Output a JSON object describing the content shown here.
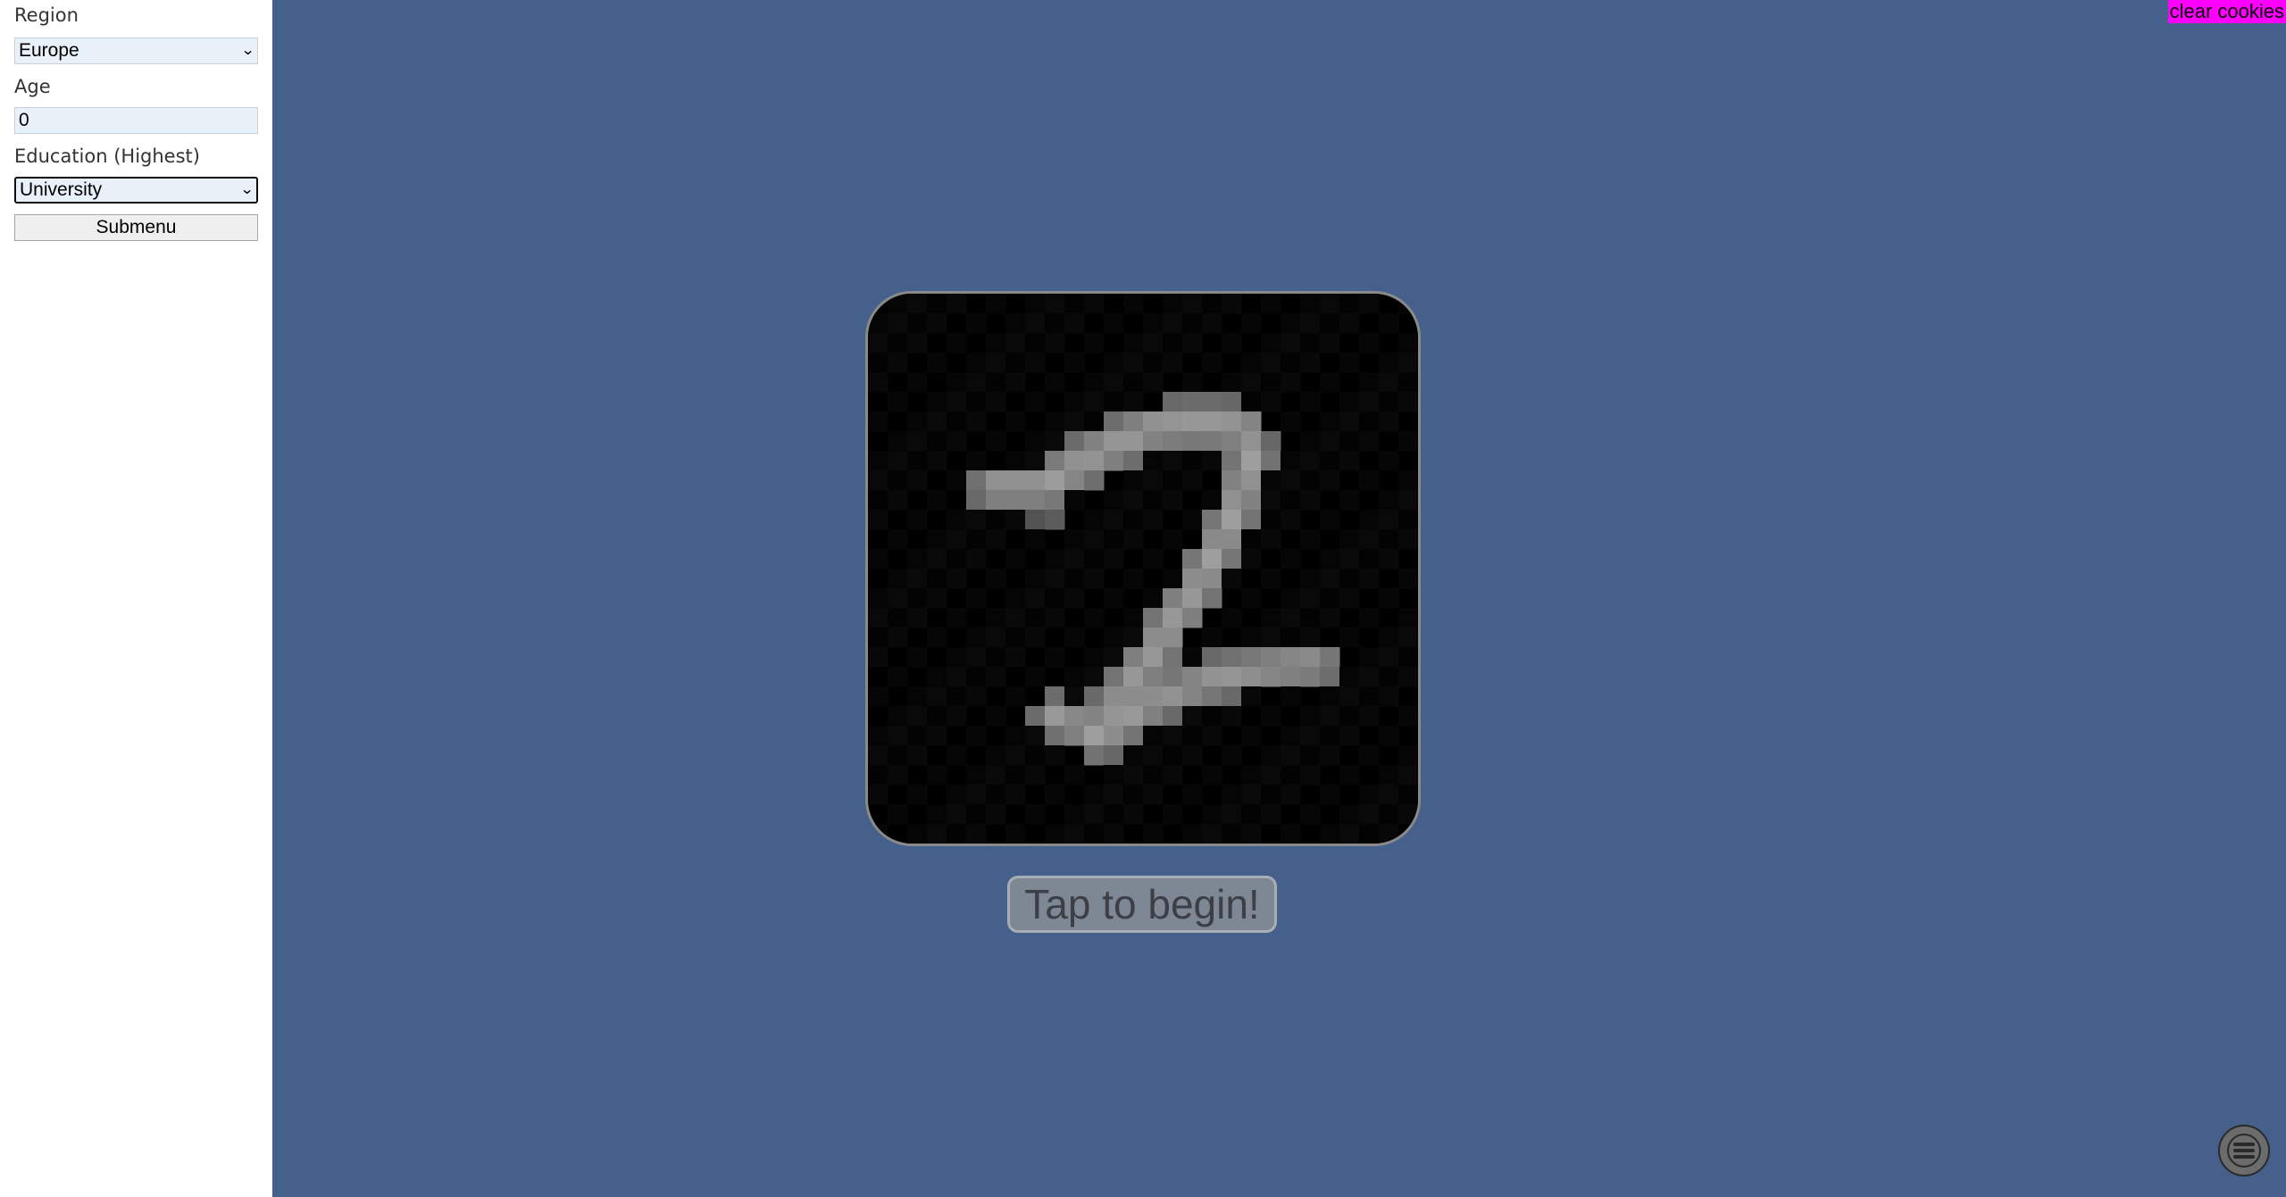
{
  "sidebar": {
    "region": {
      "label": "Region",
      "value": "Europe"
    },
    "age": {
      "label": "Age",
      "value": "0"
    },
    "education": {
      "label": "Education (Highest)",
      "value": "University"
    },
    "submenu_label": "Submenu"
  },
  "main": {
    "clear_cookies_label": "clear cookies",
    "begin_label": "Tap to begin!",
    "background_color": "#46608c",
    "menu_icon": "hamburger-menu-icon"
  }
}
